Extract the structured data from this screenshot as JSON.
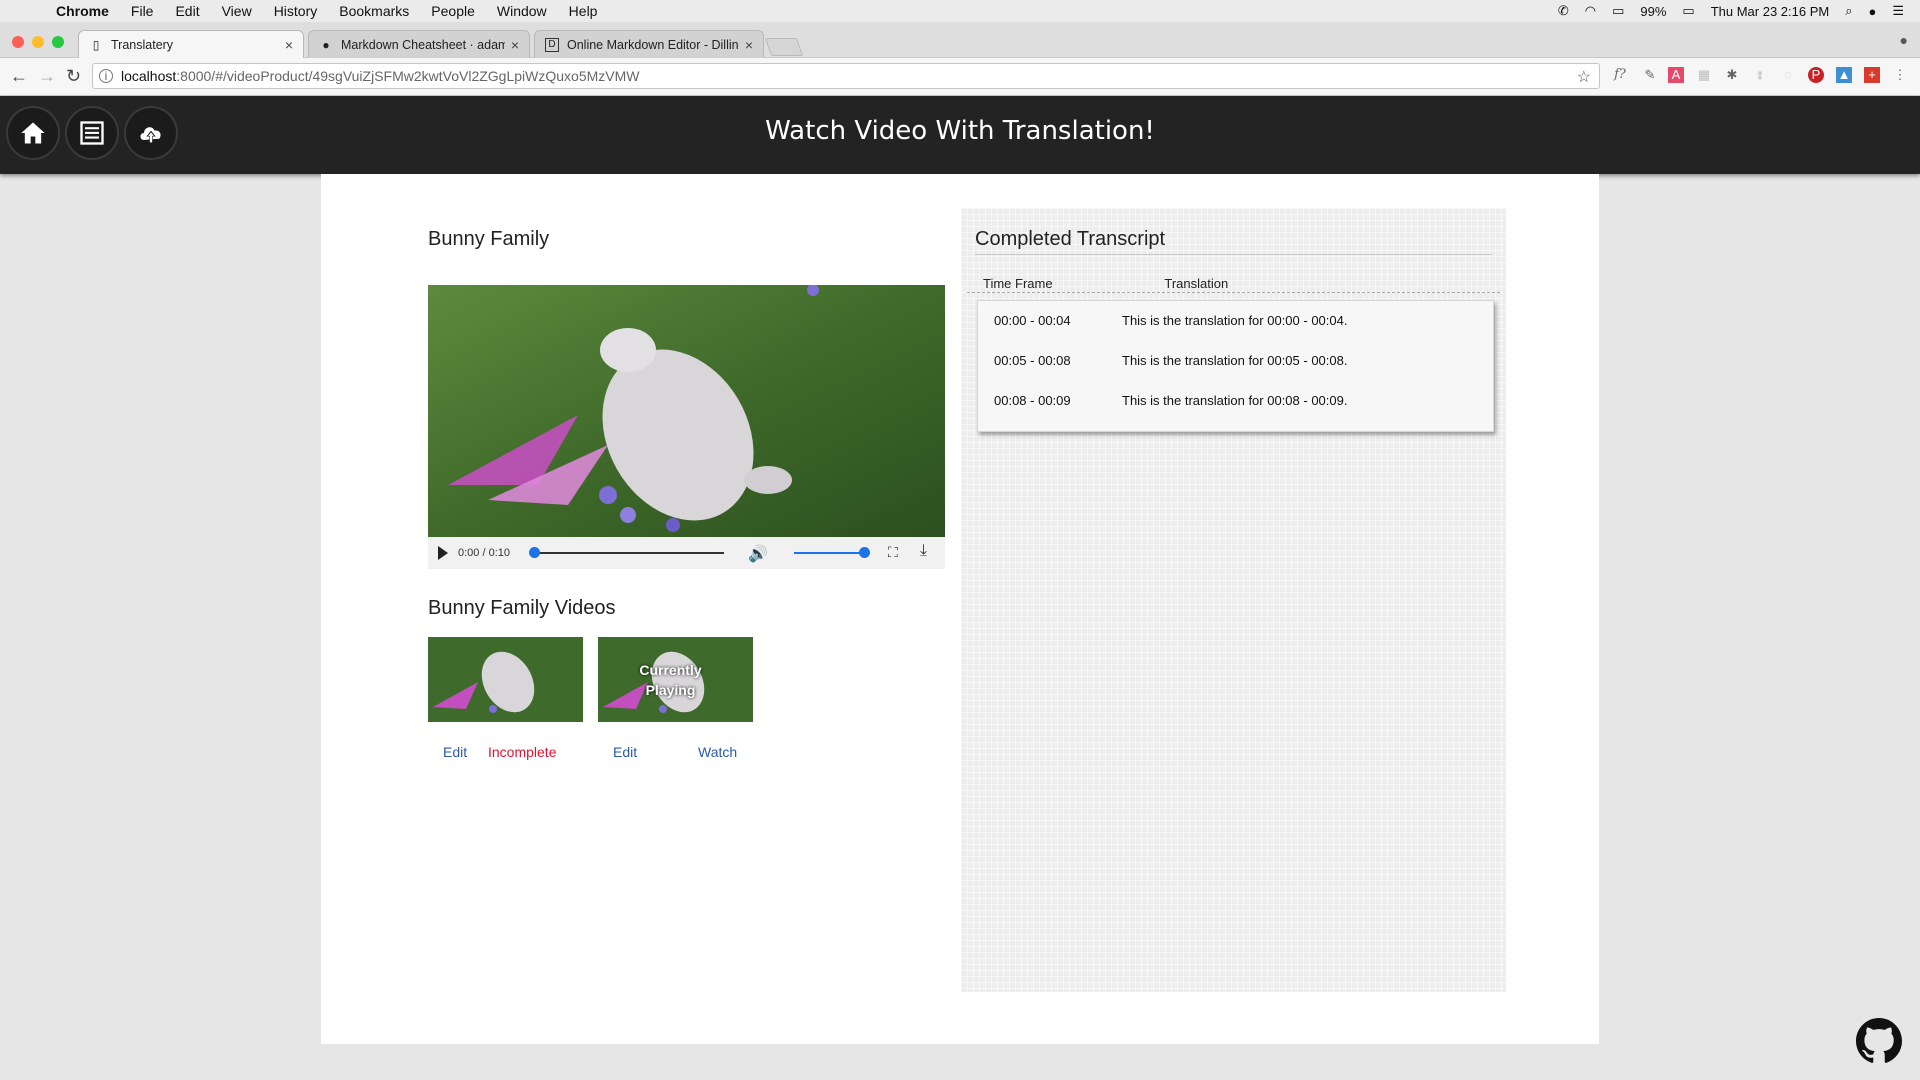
{
  "menubar": {
    "app": "Chrome",
    "items": [
      "File",
      "Edit",
      "View",
      "History",
      "Bookmarks",
      "People",
      "Window",
      "Help"
    ],
    "battery": "99%",
    "datetime": "Thu Mar 23  2:16 PM"
  },
  "browser": {
    "tabs": [
      {
        "title": "Translatery",
        "active": true
      },
      {
        "title": "Markdown Cheatsheet · adam-p",
        "active": false
      },
      {
        "title": "Online Markdown Editor - Dillinger",
        "active": false
      }
    ],
    "url_host": "localhost",
    "url_path": ":8000/#/videoProduct/49sgVuiZjSFMw2kwtVoVl2ZGgLpiWzQuxo5MzVMW"
  },
  "header": {
    "title": "Watch Video With Translation!",
    "icons": [
      "home-icon",
      "list-icon",
      "cloud-upload-icon"
    ]
  },
  "video": {
    "title": "Bunny Family",
    "time": "0:00 / 0:10",
    "progress": 0,
    "volume": 1.0
  },
  "related": {
    "title": "Bunny Family Videos",
    "items": [
      {
        "edit_label": "Edit",
        "status_label": "Incomplete",
        "overlay": ""
      },
      {
        "edit_label": "Edit",
        "status_label": "Watch",
        "overlay": "Currently Playing"
      }
    ]
  },
  "transcript": {
    "title": "Completed Transcript",
    "col_time": "Time Frame",
    "col_translation": "Translation",
    "rows": [
      {
        "time": "00:00 - 00:04",
        "text": "This is the translation for 00:00 - 00:04."
      },
      {
        "time": "00:05 - 00:08",
        "text": "This is the translation for 00:05 - 00:08."
      },
      {
        "time": "00:08 - 00:09",
        "text": "This is the translation for 00:08 - 00:09."
      }
    ]
  },
  "colors": {
    "header_bg": "#232323",
    "link_blue": "#2b5aa8",
    "incomplete_red": "#e8112d",
    "accent_blue": "#1a73e8"
  }
}
